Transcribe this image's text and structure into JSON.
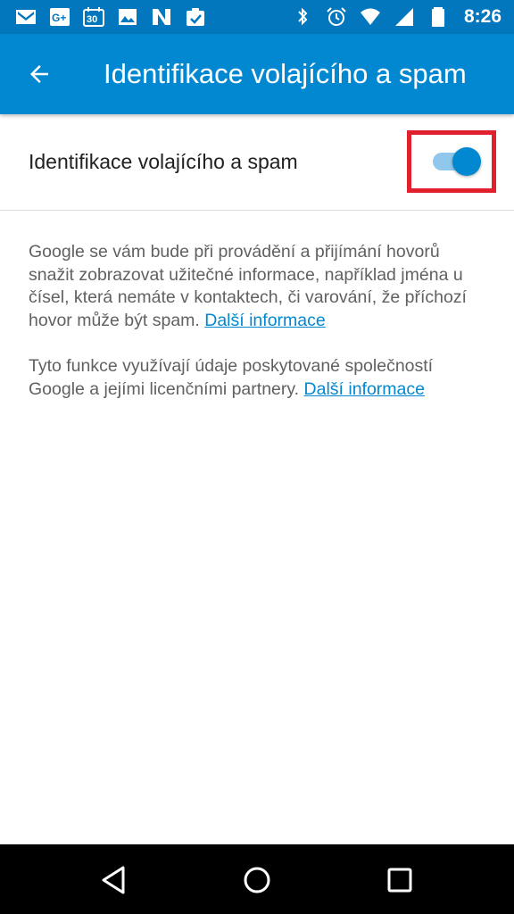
{
  "status_bar": {
    "time": "8:26",
    "left_icons": [
      "gmail-icon",
      "google-plus-icon",
      "calendar-icon",
      "photos-icon",
      "newsstand-icon",
      "task-icon"
    ],
    "right_icons": [
      "bluetooth-icon",
      "alarm-icon",
      "wifi-icon",
      "signal-icon",
      "battery-icon"
    ],
    "calendar_day": "30"
  },
  "app_bar": {
    "title": "Identifikace volajícího a spam",
    "back_icon": "arrow-back-icon"
  },
  "setting": {
    "label": "Identifikace volajícího a spam",
    "toggle_on": true
  },
  "description": {
    "paragraph1_text": "Google se vám bude při provádění a přijímání hovorů snažit zobrazovat užitečné informace, například jména u čísel, která nemáte v kontaktech, či varování, že příchozí hovor může být spam. ",
    "paragraph1_link": "Další informace",
    "paragraph2_text": "Tyto funkce využívají údaje poskytované společností Google a jejími licenčními partnery. ",
    "paragraph2_link": "Další informace"
  },
  "nav_bar": {
    "icons": [
      "nav-back-icon",
      "nav-home-icon",
      "nav-recents-icon"
    ]
  },
  "colors": {
    "status_bar": "#0277bd",
    "app_bar": "#0288d1",
    "accent": "#0288d1",
    "highlight": "#e0202c"
  }
}
